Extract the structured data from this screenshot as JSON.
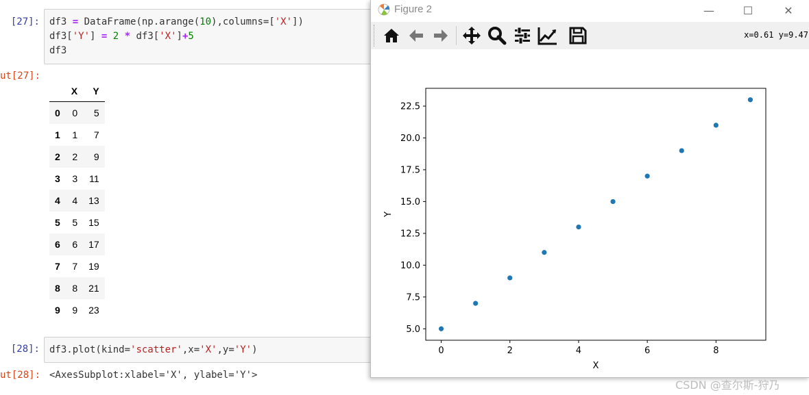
{
  "notebook": {
    "cell27": {
      "in_prompt": "[27]:",
      "out_prompt": "ut[27]:",
      "code_line1_a": "df3 ",
      "code_line1_eq": "=",
      "code_line1_b": " DataFrame(np.arange(",
      "code_line1_num": "10",
      "code_line1_c": "),columns=[",
      "code_line1_str": "'X'",
      "code_line1_d": "])",
      "code_line2_a": "df3[",
      "code_line2_str": "'Y'",
      "code_line2_b": "] ",
      "code_line2_eq": "=",
      "code_line2_sp": " ",
      "code_line2_num": "2",
      "code_line2_sp2": " ",
      "code_line2_op": "*",
      "code_line2_c": " df3[",
      "code_line2_str2": "'X'",
      "code_line2_d": "]",
      "code_line2_plus": "+",
      "code_line2_num2": "5",
      "code_line3": "df3",
      "table": {
        "columns": [
          "",
          "X",
          "Y"
        ],
        "rows": [
          [
            "0",
            "0",
            "5"
          ],
          [
            "1",
            "1",
            "7"
          ],
          [
            "2",
            "2",
            "9"
          ],
          [
            "3",
            "3",
            "11"
          ],
          [
            "4",
            "4",
            "13"
          ],
          [
            "5",
            "5",
            "15"
          ],
          [
            "6",
            "6",
            "17"
          ],
          [
            "7",
            "7",
            "19"
          ],
          [
            "8",
            "8",
            "21"
          ],
          [
            "9",
            "9",
            "23"
          ]
        ]
      }
    },
    "cell28": {
      "in_prompt": "[28]:",
      "out_prompt": "ut[28]:",
      "code_a": "df3.plot(kind=",
      "code_str1": "'scatter'",
      "code_b": ",x=",
      "code_str2": "'X'",
      "code_c": ",y=",
      "code_str3": "'Y'",
      "code_d": ")",
      "output": "<AxesSubplot:xlabel='X', ylabel='Y'>"
    }
  },
  "figure_window": {
    "title": "Figure 2",
    "minimize": "—",
    "maximize": "☐",
    "close": "✕",
    "coordinates": "x=0.61 y=9.47",
    "toolbar": [
      "home-icon",
      "back-arrow-icon",
      "forward-arrow-icon",
      "pan-icon",
      "zoom-icon",
      "subplots-icon",
      "edit-axes-icon",
      "save-icon"
    ]
  },
  "chart_data": {
    "type": "scatter",
    "x": [
      0,
      1,
      2,
      3,
      4,
      5,
      6,
      7,
      8,
      9
    ],
    "y": [
      5,
      7,
      9,
      11,
      13,
      15,
      17,
      19,
      21,
      23
    ],
    "xlabel": "X",
    "ylabel": "Y",
    "xlim": [
      -0.45,
      9.45
    ],
    "ylim": [
      4.1,
      23.9
    ],
    "xticks": [
      "0",
      "2",
      "4",
      "6",
      "8"
    ],
    "yticks": [
      "5.0",
      "7.5",
      "10.0",
      "12.5",
      "15.0",
      "17.5",
      "20.0",
      "22.5"
    ],
    "marker_color": "#1f77b4"
  },
  "watermark": "CSDN @查尔斯-狩乃"
}
